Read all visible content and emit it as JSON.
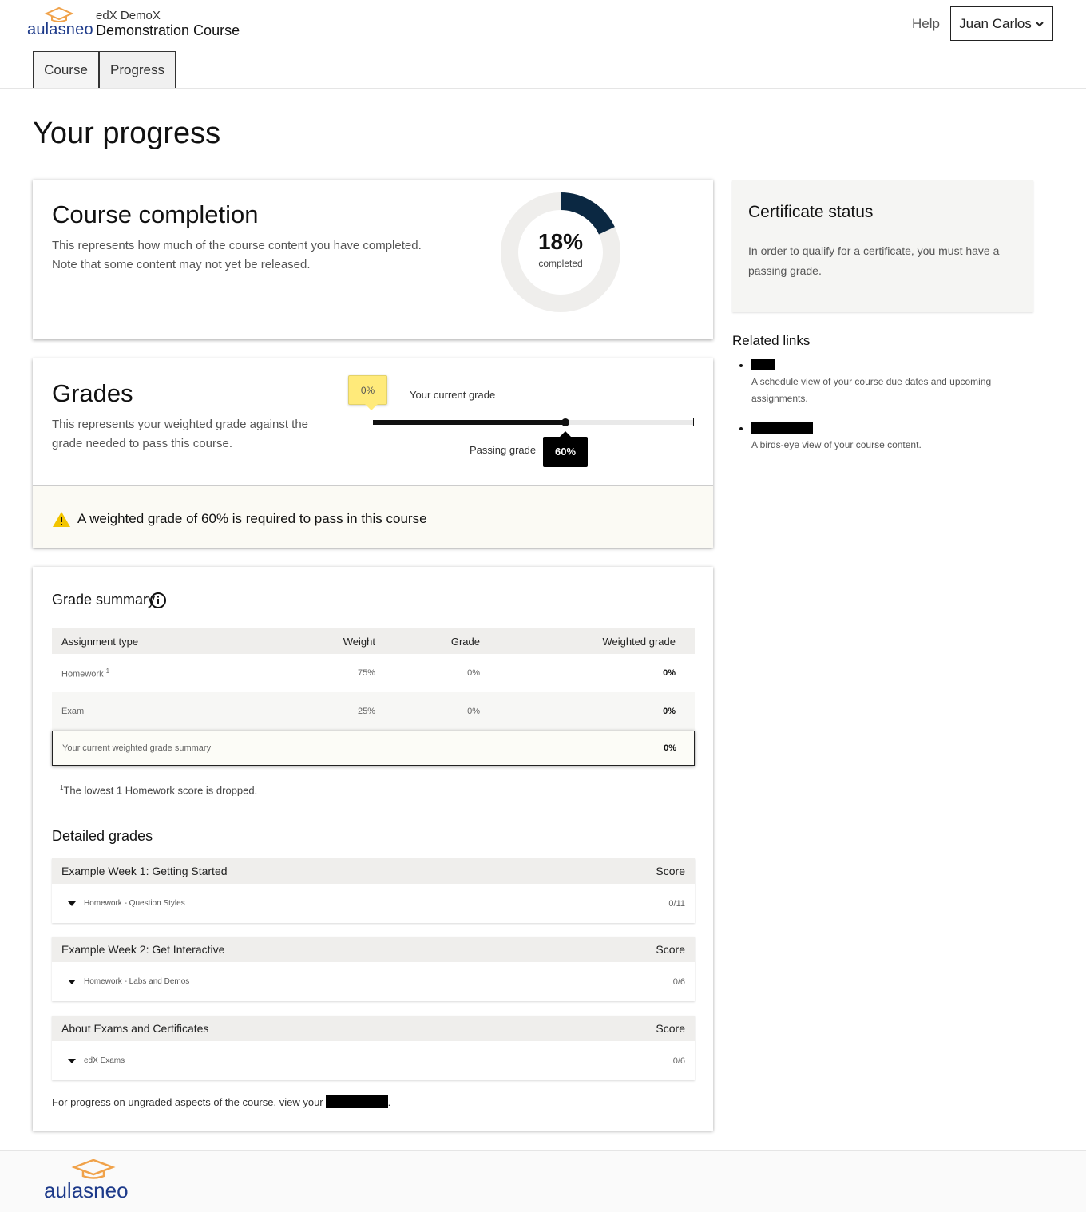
{
  "brand": {
    "name": "aulasneo",
    "accent": "#f0a24a",
    "primary": "#1d3a8a"
  },
  "header": {
    "course_org": "edX DemoX",
    "course_title": "Demonstration Course",
    "help": "Help",
    "user_name": "Juan Carlos"
  },
  "tabs": [
    {
      "label": "Course"
    },
    {
      "label": "Progress"
    }
  ],
  "page": {
    "title": "Your progress"
  },
  "completion": {
    "title": "Course completion",
    "description": "This represents how much of the course content you have completed. Note that some content may not yet be released.",
    "percent_text": "18%",
    "percent_value": 0.18,
    "percent_label": "completed"
  },
  "grades": {
    "title": "Grades",
    "description": "This represents your weighted grade against the grade needed to pass this course.",
    "current_grade_text": "0%",
    "current_grade_value": 0,
    "current_grade_label": "Your current grade",
    "passing_grade_text": "60%",
    "passing_grade_value": 0.6,
    "passing_grade_label": "Passing grade",
    "requirement_text": "A weighted grade of 60% is required to pass in this course"
  },
  "summary": {
    "title": "Grade summary",
    "headers": [
      "Assignment type",
      "Weight",
      "Grade",
      "Weighted grade"
    ],
    "rows": [
      {
        "type": "Homework",
        "sup": "1",
        "weight": "75%",
        "grade": "0%",
        "weighted": "0%"
      },
      {
        "type": "Exam",
        "sup": "",
        "weight": "25%",
        "grade": "0%",
        "weighted": "0%"
      }
    ],
    "total_label": "Your current weighted grade summary",
    "total_value": "0%",
    "footnote_sup": "1",
    "footnote": "The lowest 1 Homework score is dropped."
  },
  "detailed": {
    "title": "Detailed grades",
    "score_header": "Score",
    "groups": [
      {
        "name": "Example Week 1: Getting Started",
        "item": "Homework - Question Styles",
        "score": "0/11"
      },
      {
        "name": "Example Week 2: Get Interactive",
        "item": "Homework - Labs and Demos",
        "score": "0/6"
      },
      {
        "name": "About Exams and Certificates",
        "item": "edX Exams",
        "score": "0/6"
      }
    ],
    "ungraded_text": "For progress on ungraded aspects of the course, view your",
    "ungraded_end": "."
  },
  "certificate": {
    "title": "Certificate status",
    "description": "In order to qualify for a certificate, you must have a passing grade."
  },
  "related": {
    "title": "Related links",
    "items": [
      {
        "description": "A schedule view of your course due dates and upcoming assignments."
      },
      {
        "description": "A birds-eye view of your course content."
      }
    ]
  }
}
